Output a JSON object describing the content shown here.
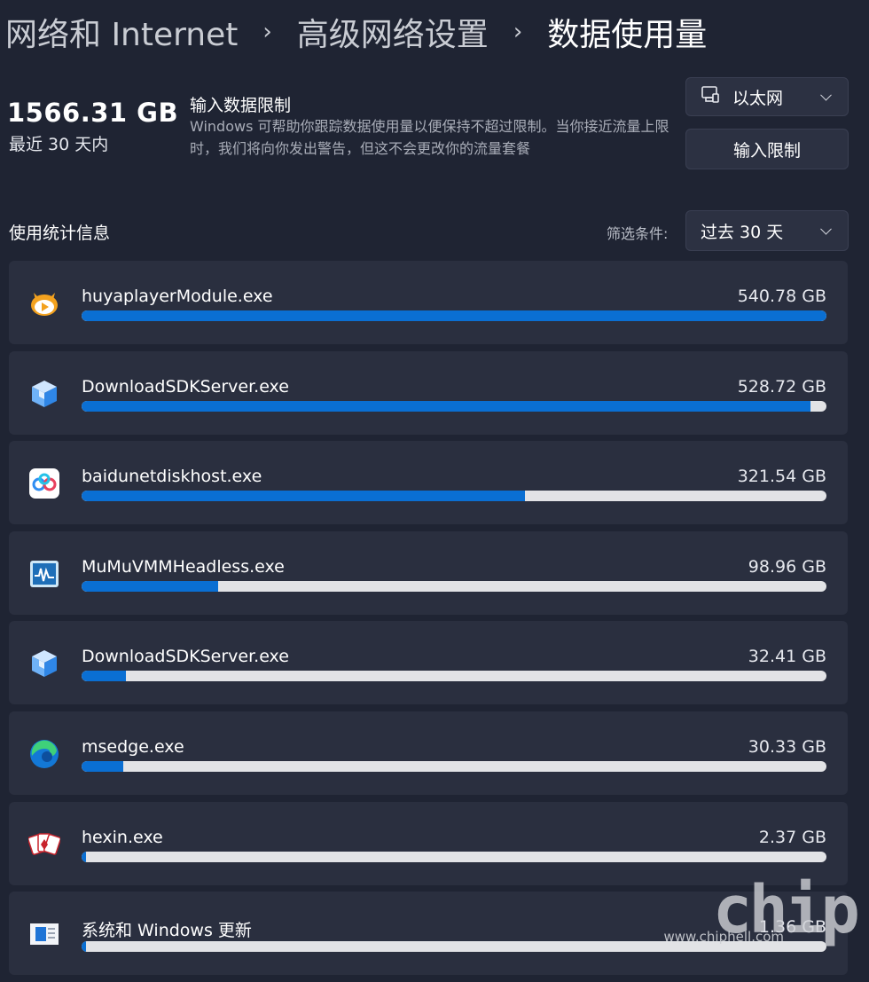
{
  "breadcrumb": {
    "items": [
      "网络和 Internet",
      "高级网络设置",
      "数据使用量"
    ],
    "separator": "›"
  },
  "summary": {
    "total": "1566.31 GB",
    "period": "最近 30 天内"
  },
  "limit": {
    "title": "输入数据限制",
    "description": "Windows 可帮助你跟踪数据使用量以便保持不超过限制。当你接近流量上限时，我们将向你发出警告，但这不会更改你的流量套餐",
    "button_label": "输入限制"
  },
  "network_dropdown": {
    "icon": "ethernet-icon",
    "selected": "以太网"
  },
  "stats": {
    "title": "使用统计信息",
    "filter_label": "筛选条件:",
    "filter_selected": "过去 30 天"
  },
  "apps": [
    {
      "name": "huyaplayerModule.exe",
      "size": "540.78 GB",
      "usage_fraction": 1.0,
      "icon": "huya-icon"
    },
    {
      "name": "DownloadSDKServer.exe",
      "size": "528.72 GB",
      "usage_fraction": 0.978,
      "icon": "download-sdk-cube-icon"
    },
    {
      "name": "baidunetdiskhost.exe",
      "size": "321.54 GB",
      "usage_fraction": 0.595,
      "icon": "baidu-netdisk-icon"
    },
    {
      "name": "MuMuVMMHeadless.exe",
      "size": "98.96 GB",
      "usage_fraction": 0.183,
      "icon": "mumu-monitor-icon"
    },
    {
      "name": "DownloadSDKServer.exe",
      "size": "32.41 GB",
      "usage_fraction": 0.06,
      "icon": "download-sdk-cube-icon"
    },
    {
      "name": "msedge.exe",
      "size": "30.33 GB",
      "usage_fraction": 0.056,
      "icon": "edge-icon"
    },
    {
      "name": "hexin.exe",
      "size": "2.37 GB",
      "usage_fraction": 0.0044,
      "icon": "hexin-cards-icon"
    },
    {
      "name": "系统和 Windows 更新",
      "size": "1.36 GB",
      "usage_fraction": 0.0025,
      "icon": "windows-update-icon"
    }
  ],
  "colors": {
    "background": "#1f2433",
    "card": "#2a2f3f",
    "bar_fill": "#0a6fd3",
    "bar_track": "#e2e3e6"
  },
  "watermark": {
    "logo": "chip",
    "url": "www.chiphell.com"
  }
}
